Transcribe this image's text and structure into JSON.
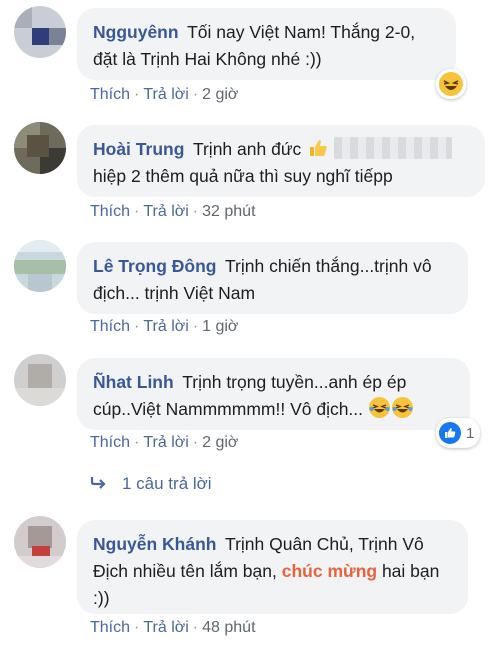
{
  "comments": [
    {
      "author": "Ngguyênn",
      "text": "Tối nay Việt Nam! Thắng 2-0, đặt là Trịnh Hai Không nhé :))",
      "like_label": "Thích",
      "reply_label": "Trả lời",
      "time": "2 giờ",
      "reaction": "haha"
    },
    {
      "author": "Hoài Trung",
      "text_a": "Trịnh anh đức",
      "text_b": "hiệp 2 thêm quả nữa thì suy nghĩ tiếpp",
      "like_label": "Thích",
      "reply_label": "Trả lời",
      "time": "32 phút",
      "icon": "thumbs-up-emoji"
    },
    {
      "author": "Lê Trọng Đông",
      "text": "Trịnh chiến thắng...trịnh vô địch... trịnh Việt Nam",
      "like_label": "Thích",
      "reply_label": "Trả lời",
      "time": "1 giờ"
    },
    {
      "author": "Ñhat Linh",
      "text": "Trịnh trọng tuyền...anh ép ép cúp..Việt Nammmmmm!! Vô địch...",
      "like_label": "Thích",
      "reply_label": "Trả lời",
      "time": "2 giờ",
      "reaction": "like",
      "reaction_count": "1"
    },
    {
      "author": "Nguyễn Khánh",
      "text_a": "Trịnh Quân Chủ, Trịnh Vô Địch nhiều tên lắm bạn,",
      "highlight": "chúc mừng",
      "text_b": "hai bạn :))",
      "like_label": "Thích",
      "reply_label": "Trả lời",
      "time": "48 phút"
    }
  ],
  "replies_link": "1 câu trả lời",
  "colors": {
    "author": "#385898",
    "bubble": "#f2f3f5",
    "action": "#4b67a1",
    "highlight": "#e8633c"
  }
}
